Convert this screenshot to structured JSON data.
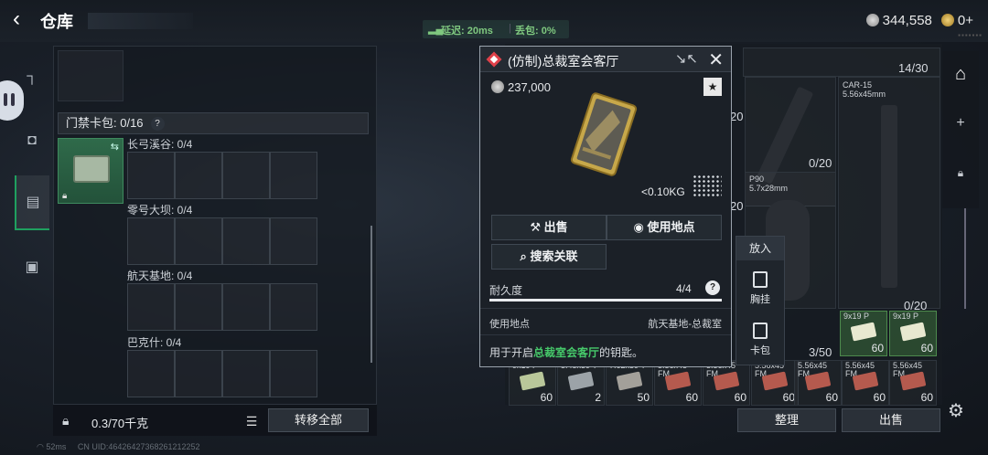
{
  "header": {
    "title": "仓库",
    "latency_label": "延迟: 20ms",
    "packet_loss_label": "丢包: 0%",
    "silver_amount": "344,558",
    "gold_amount": "0+"
  },
  "left_panel": {
    "keycard_header": "门禁卡包: 0/16",
    "zones": [
      {
        "label": "长弓溪谷: 0/4"
      },
      {
        "label": "零号大坝: 0/4"
      },
      {
        "label": "航天基地: 0/4"
      },
      {
        "label": "巴克什: 0/4"
      }
    ],
    "footer_weight": "0.3/70千克",
    "transfer_all_label": "转移全部"
  },
  "bottom_status": {
    "ping": "52ms",
    "ids": "CN UID:46426427368261212252"
  },
  "item_popup": {
    "title": "(仿制)总裁室会客厅",
    "price": "237,000",
    "weight": "<0.10KG",
    "sell_label": "出售",
    "use_location_label": "使用地点",
    "search_related_label": "搜索关联",
    "durability_label": "耐久度",
    "durability_value": "4/4",
    "durability_fraction": 1.0,
    "location_label": "使用地点",
    "location_value": "航天基地-总裁室",
    "desc_prefix": "用于开启",
    "desc_highlight": "总裁室会客厅",
    "desc_suffix": "的钥匙。"
  },
  "side_menu": {
    "put_in_label": "放入",
    "chest_rig_label": "胸挂",
    "card_pack_label": "卡包"
  },
  "stash": {
    "count_top": "14/30",
    "weapon_car15": {
      "name": "CAR-15",
      "caliber": "5.56x45mm"
    },
    "weapon_p90": {
      "name": "P90",
      "caliber": "5.7x28mm"
    },
    "count_a": "20",
    "count_b": "0/20",
    "count_c": "20",
    "count_d": "0/20",
    "count_e": "3/50",
    "ammo_row1": [
      {
        "cal": "9x19 P",
        "count": "60"
      },
      {
        "cal": "9x19 P",
        "count": "60"
      }
    ],
    "ammo_row2": [
      {
        "cal": "9x19 P",
        "count": "60"
      },
      {
        "cal": "5.45x39 T",
        "count": "2"
      },
      {
        "cal": "7.62x39 T",
        "count": "50"
      },
      {
        "cal": "5.56x45 FM",
        "count": "60"
      },
      {
        "cal": "5.56x45 FM",
        "count": "60"
      },
      {
        "cal": "5.56x45 FM",
        "count": "60"
      },
      {
        "cal": "5.56x45 FM",
        "count": "60"
      },
      {
        "cal": "5.56x45 FM",
        "count": "60"
      },
      {
        "cal": "5.56x45 FM",
        "count": "60"
      }
    ],
    "tidy_label": "整理",
    "sell_label": "出售"
  },
  "colors": {
    "accent_green": "#1fa05f",
    "highlight_green": "#46c86a",
    "rarity_red": "#e0414a"
  },
  "icons": [
    "back-arrow-icon",
    "signal-icon",
    "silver-coin-icon",
    "gold-coin-icon",
    "gun-icon",
    "helmet-icon",
    "backpack-icon",
    "case-icon",
    "lock-icon",
    "swap-icon",
    "list-icon",
    "star-icon",
    "collapse-icon",
    "close-icon",
    "cart-icon",
    "location-pin-icon",
    "search-icon",
    "help-icon",
    "settings-gear-icon",
    "plus-icon",
    "home-icon"
  ]
}
